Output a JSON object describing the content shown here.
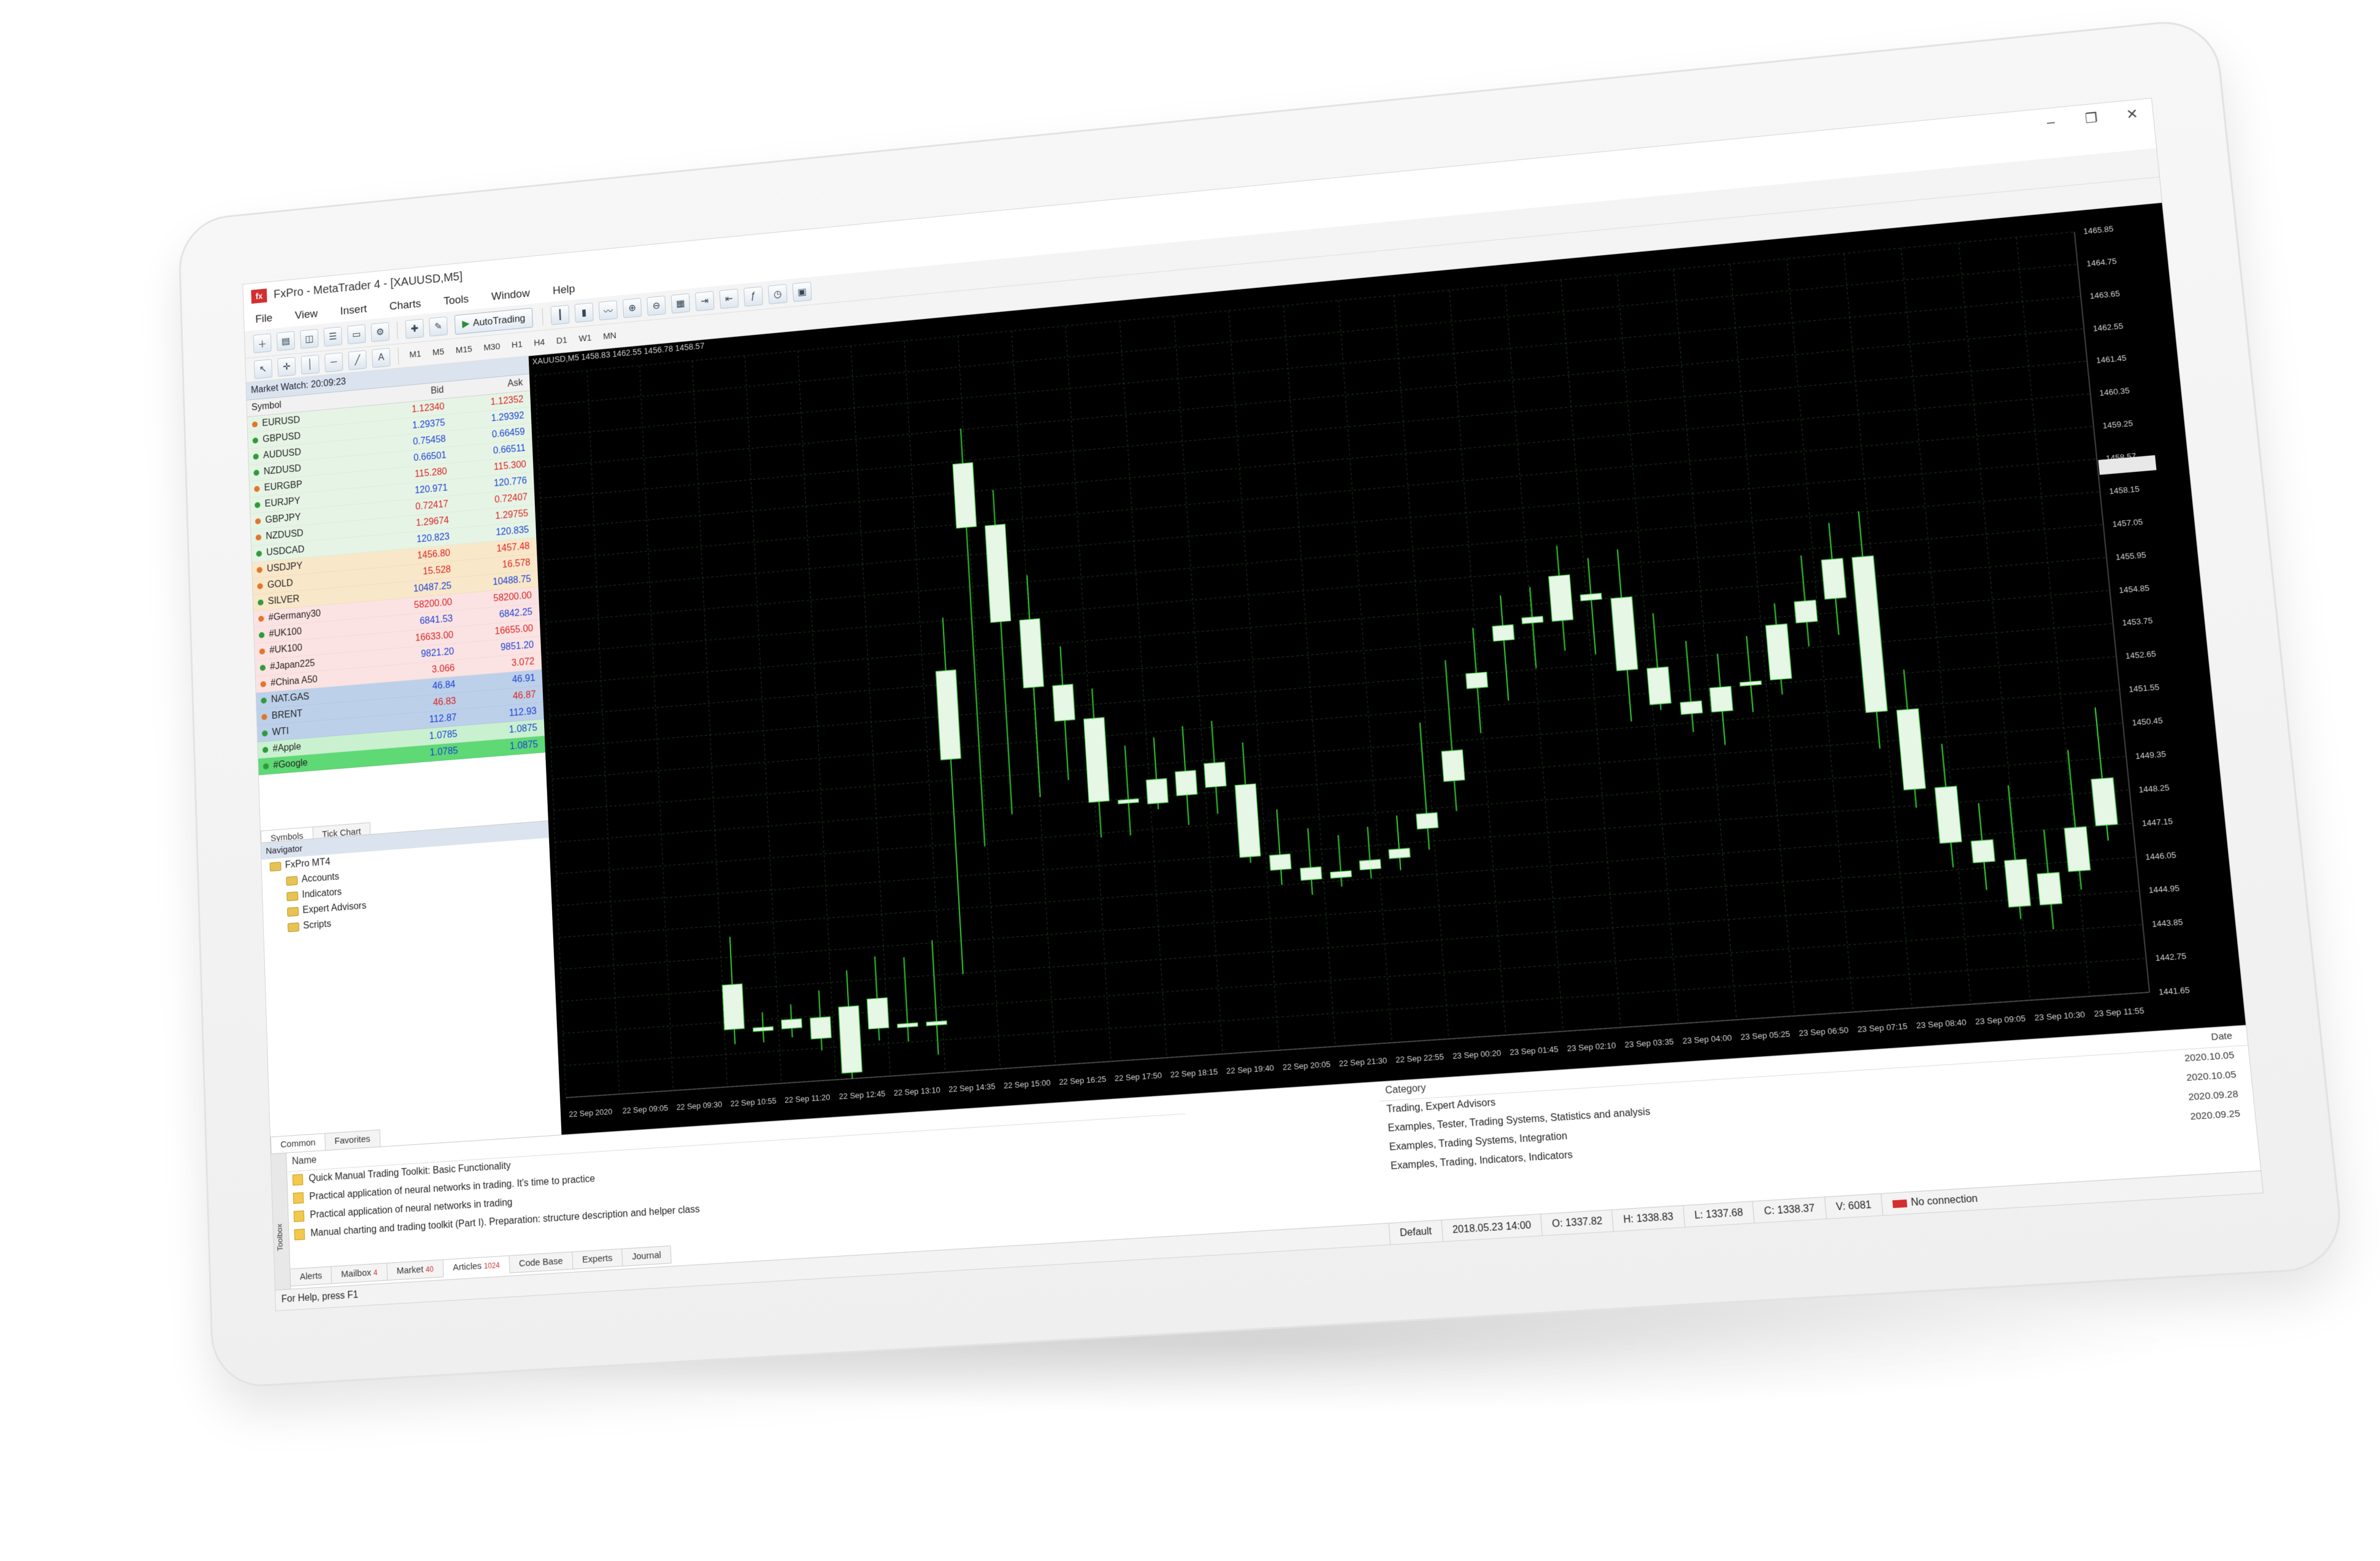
{
  "window": {
    "title": "FxPro - MetaTrader 4 - [XAUUSD,M5]",
    "controls": [
      "–",
      "❐",
      "✕"
    ]
  },
  "menu": [
    "File",
    "View",
    "Insert",
    "Charts",
    "Tools",
    "Window",
    "Help"
  ],
  "toolbar": {
    "autotrading_label": "AutoTrading",
    "timeframes": [
      "M1",
      "M5",
      "M15",
      "M30",
      "H1",
      "H4",
      "D1",
      "W1",
      "MN"
    ]
  },
  "market_watch": {
    "title": "Market Watch: 20:09:23",
    "columns": [
      "Symbol",
      "Bid",
      "Ask"
    ],
    "rows": [
      {
        "symbol": "EURUSD",
        "bid": "1.12340",
        "ask": "1.12352",
        "dir": "down",
        "bg": "#e6f4e6"
      },
      {
        "symbol": "GBPUSD",
        "bid": "1.29375",
        "ask": "1.29392",
        "dir": "up",
        "bg": "#e6f4e6"
      },
      {
        "symbol": "AUDUSD",
        "bid": "0.75458",
        "ask": "0.66459",
        "dir": "up",
        "bg": "#e6f4e6"
      },
      {
        "symbol": "NZDUSD",
        "bid": "0.66501",
        "ask": "0.66511",
        "dir": "up",
        "bg": "#e6f4e6"
      },
      {
        "symbol": "EURGBP",
        "bid": "115.280",
        "ask": "115.300",
        "dir": "down",
        "bg": "#e6f4e6"
      },
      {
        "symbol": "EURJPY",
        "bid": "120.971",
        "ask": "120.776",
        "dir": "up",
        "bg": "#e6f4e6"
      },
      {
        "symbol": "GBPJPY",
        "bid": "0.72417",
        "ask": "0.72407",
        "dir": "down",
        "bg": "#e6f4e6"
      },
      {
        "symbol": "NZDUSD",
        "bid": "1.29674",
        "ask": "1.29755",
        "dir": "down",
        "bg": "#e6f4e6"
      },
      {
        "symbol": "USDCAD",
        "bid": "120.823",
        "ask": "120.835",
        "dir": "up",
        "bg": "#e6f4e6"
      },
      {
        "symbol": "USDJPY",
        "bid": "1456.80",
        "ask": "1457.48",
        "dir": "down",
        "bg": "#f9e7c9"
      },
      {
        "symbol": "GOLD",
        "bid": "15.528",
        "ask": "16.578",
        "dir": "down",
        "bg": "#f9e7c9"
      },
      {
        "symbol": "SILVER",
        "bid": "10487.25",
        "ask": "10488.75",
        "dir": "up",
        "bg": "#f9e7c9"
      },
      {
        "symbol": "#Germany30",
        "bid": "58200.00",
        "ask": "58200.00",
        "dir": "down",
        "bg": "#fbe3e3"
      },
      {
        "symbol": "#UK100",
        "bid": "6841.53",
        "ask": "6842.25",
        "dir": "up",
        "bg": "#fbe3e3"
      },
      {
        "symbol": "#UK100",
        "bid": "16633.00",
        "ask": "16655.00",
        "dir": "down",
        "bg": "#fbe3e3"
      },
      {
        "symbol": "#Japan225",
        "bid": "9821.20",
        "ask": "9851.20",
        "dir": "up",
        "bg": "#fbe3e3"
      },
      {
        "symbol": "#China A50",
        "bid": "3.066",
        "ask": "3.072",
        "dir": "down",
        "bg": "#fbe3e3"
      },
      {
        "symbol": "NAT.GAS",
        "bid": "46.84",
        "ask": "46.91",
        "dir": "up",
        "bg": "#bcd0ea"
      },
      {
        "symbol": "BRENT",
        "bid": "46.83",
        "ask": "46.87",
        "dir": "down",
        "bg": "#bcd0ea"
      },
      {
        "symbol": "WTI",
        "bid": "112.87",
        "ask": "112.93",
        "dir": "up",
        "bg": "#bcd0ea"
      },
      {
        "symbol": "#Apple",
        "bid": "1.0785",
        "ask": "1.0875",
        "dir": "up",
        "bg": "#c9f1cf"
      },
      {
        "symbol": "#Google",
        "bid": "1.0785",
        "ask": "1.0875",
        "dir": "up",
        "bg": "#5fd876"
      }
    ],
    "tabs": [
      "Symbols",
      "Tick Chart"
    ]
  },
  "navigator": {
    "title": "Navigator",
    "items": [
      "FxPro MT4",
      "Accounts",
      "Indicators",
      "Expert Advisors",
      "Scripts"
    ],
    "tabs": [
      "Common",
      "Favorites"
    ]
  },
  "chart": {
    "header": "XAUUSD,M5  1458.83 1462.55 1456.78 1458.57",
    "price_labels": [
      "1465.85",
      "1464.75",
      "1463.65",
      "1462.55",
      "1461.45",
      "1460.35",
      "1459.25",
      "1458.57",
      "1458.15",
      "1457.05",
      "1455.95",
      "1454.85",
      "1453.75",
      "1452.65",
      "1451.55",
      "1450.45",
      "1449.35",
      "1448.25",
      "1447.15",
      "1446.05",
      "1444.95",
      "1443.85",
      "1442.75",
      "1441.65"
    ],
    "time_labels": [
      "22 Sep 2020",
      "22 Sep 09:05",
      "22 Sep 09:30",
      "22 Sep 10:55",
      "22 Sep 11:20",
      "22 Sep 12:45",
      "22 Sep 13:10",
      "22 Sep 14:35",
      "22 Sep 15:00",
      "22 Sep 16:25",
      "22 Sep 17:50",
      "22 Sep 18:15",
      "22 Sep 19:40",
      "22 Sep 20:05",
      "22 Sep 21:30",
      "22 Sep 22:55",
      "23 Sep 00:20",
      "23 Sep 01:45",
      "23 Sep 02:10",
      "23 Sep 03:35",
      "23 Sep 04:00",
      "23 Sep 05:25",
      "23 Sep 06:50",
      "23 Sep 07:15",
      "23 Sep 08:40",
      "23 Sep 09:05",
      "23 Sep 10:30",
      "23 Sep 11:55"
    ],
    "colors": {
      "background": "#000000",
      "grid": "#1f3a1f",
      "wick": "#2fcf2f",
      "body": "#e6f7e6"
    }
  },
  "chart_data": {
    "type": "candlestick",
    "candles": [
      {
        "o": 1445.0,
        "h": 1446.6,
        "l": 1443.0,
        "c": 1443.5
      },
      {
        "o": 1443.5,
        "h": 1444.0,
        "l": 1443.0,
        "c": 1443.4
      },
      {
        "o": 1443.4,
        "h": 1444.2,
        "l": 1443.1,
        "c": 1443.7
      },
      {
        "o": 1443.7,
        "h": 1444.6,
        "l": 1442.6,
        "c": 1443.0
      },
      {
        "o": 1444.0,
        "h": 1445.2,
        "l": 1441.6,
        "c": 1441.8
      },
      {
        "o": 1444.2,
        "h": 1445.6,
        "l": 1442.8,
        "c": 1443.2
      },
      {
        "o": 1443.2,
        "h": 1445.5,
        "l": 1442.7,
        "c": 1443.3
      },
      {
        "o": 1443.3,
        "h": 1446.0,
        "l": 1442.2,
        "c": 1443.2
      },
      {
        "o": 1455.0,
        "h": 1456.8,
        "l": 1444.8,
        "c": 1452.0
      },
      {
        "o": 1462.0,
        "h": 1463.2,
        "l": 1449.0,
        "c": 1459.8
      },
      {
        "o": 1459.8,
        "h": 1461.0,
        "l": 1450.0,
        "c": 1456.5
      },
      {
        "o": 1456.5,
        "h": 1458.0,
        "l": 1450.5,
        "c": 1454.2
      },
      {
        "o": 1454.2,
        "h": 1455.5,
        "l": 1451.0,
        "c": 1453.0
      },
      {
        "o": 1453.0,
        "h": 1454.0,
        "l": 1449.0,
        "c": 1450.2
      },
      {
        "o": 1450.2,
        "h": 1452.0,
        "l": 1449.0,
        "c": 1450.2
      },
      {
        "o": 1450.8,
        "h": 1452.2,
        "l": 1449.8,
        "c": 1450.0
      },
      {
        "o": 1451.0,
        "h": 1452.5,
        "l": 1449.2,
        "c": 1450.2
      },
      {
        "o": 1451.2,
        "h": 1452.6,
        "l": 1449.5,
        "c": 1450.4
      },
      {
        "o": 1450.4,
        "h": 1451.8,
        "l": 1447.8,
        "c": 1448.0
      },
      {
        "o": 1448.0,
        "h": 1449.5,
        "l": 1447.0,
        "c": 1447.5
      },
      {
        "o": 1447.5,
        "h": 1448.8,
        "l": 1446.6,
        "c": 1447.1
      },
      {
        "o": 1447.1,
        "h": 1448.5,
        "l": 1446.8,
        "c": 1447.3
      },
      {
        "o": 1447.3,
        "h": 1448.7,
        "l": 1447.0,
        "c": 1447.6
      },
      {
        "o": 1447.6,
        "h": 1449.0,
        "l": 1447.2,
        "c": 1447.9
      },
      {
        "o": 1448.5,
        "h": 1452.0,
        "l": 1447.8,
        "c": 1449.0
      },
      {
        "o": 1450.0,
        "h": 1454.0,
        "l": 1449.0,
        "c": 1451.0
      },
      {
        "o": 1453.0,
        "h": 1455.0,
        "l": 1451.5,
        "c": 1453.5
      },
      {
        "o": 1454.5,
        "h": 1456.0,
        "l": 1452.5,
        "c": 1455.0
      },
      {
        "o": 1455.0,
        "h": 1456.2,
        "l": 1453.5,
        "c": 1455.2
      },
      {
        "o": 1456.5,
        "h": 1457.5,
        "l": 1454.0,
        "c": 1455.0
      },
      {
        "o": 1455.8,
        "h": 1457.0,
        "l": 1453.8,
        "c": 1455.6
      },
      {
        "o": 1455.6,
        "h": 1457.2,
        "l": 1451.5,
        "c": 1453.2
      },
      {
        "o": 1453.2,
        "h": 1455.0,
        "l": 1451.8,
        "c": 1452.0
      },
      {
        "o": 1452.0,
        "h": 1454.0,
        "l": 1451.0,
        "c": 1451.6
      },
      {
        "o": 1451.6,
        "h": 1453.5,
        "l": 1450.5,
        "c": 1452.4
      },
      {
        "o": 1452.4,
        "h": 1454.0,
        "l": 1451.5,
        "c": 1452.5
      },
      {
        "o": 1452.5,
        "h": 1455.0,
        "l": 1452.0,
        "c": 1454.3
      },
      {
        "o": 1454.3,
        "h": 1456.5,
        "l": 1453.5,
        "c": 1455.0
      },
      {
        "o": 1455.0,
        "h": 1457.5,
        "l": 1453.8,
        "c": 1456.3
      },
      {
        "o": 1456.3,
        "h": 1457.8,
        "l": 1450.0,
        "c": 1451.2
      },
      {
        "o": 1451.2,
        "h": 1452.5,
        "l": 1448.0,
        "c": 1448.6
      },
      {
        "o": 1448.6,
        "h": 1450.0,
        "l": 1446.0,
        "c": 1446.8
      },
      {
        "o": 1446.8,
        "h": 1448.0,
        "l": 1445.2,
        "c": 1446.1
      },
      {
        "o": 1446.1,
        "h": 1448.5,
        "l": 1444.2,
        "c": 1444.6
      },
      {
        "o": 1444.6,
        "h": 1447.0,
        "l": 1443.8,
        "c": 1445.6
      },
      {
        "o": 1445.6,
        "h": 1449.5,
        "l": 1445.0,
        "c": 1447.0
      },
      {
        "o": 1447.0,
        "h": 1450.8,
        "l": 1446.5,
        "c": 1448.5
      }
    ],
    "ylim": [
      1441.6,
      1466.4
    ]
  },
  "toolbox": {
    "side_label": "Toolbox",
    "articles_header": "Name",
    "articles": [
      "Quick Manual Trading Toolkit: Basic Functionality",
      "Practical application of neural networks in trading. It's time to practice",
      "Practical application of neural networks in trading",
      "Manual charting and trading toolkit (Part I). Preparation: structure description and helper class"
    ],
    "category_header": "Category",
    "categories": [
      "Trading, Expert Advisors",
      "Examples, Tester, Trading Systems, Statistics and analysis",
      "Examples, Trading Systems, Integration",
      "Examples, Trading, Indicators, Indicators"
    ],
    "date_header": "Date",
    "dates": [
      "2020.10.05",
      "2020.10.05",
      "2020.09.28",
      "2020.09.25"
    ],
    "tabs": [
      {
        "label": "Alerts",
        "badge": ""
      },
      {
        "label": "Mailbox",
        "badge": "4"
      },
      {
        "label": "Market",
        "badge": "40"
      },
      {
        "label": "Articles",
        "badge": "1024"
      },
      {
        "label": "Code Base",
        "badge": ""
      },
      {
        "label": "Experts",
        "badge": ""
      },
      {
        "label": "Journal",
        "badge": ""
      }
    ]
  },
  "statusbar": {
    "help": "For Help, press F1",
    "profile": "Default",
    "datetime": "2018.05.23 14:00",
    "open": "O: 1337.82",
    "high": "H: 1338.83",
    "low": "L: 1337.68",
    "close": "C: 1338.37",
    "volume": "V: 6081",
    "connection": "No connection"
  }
}
